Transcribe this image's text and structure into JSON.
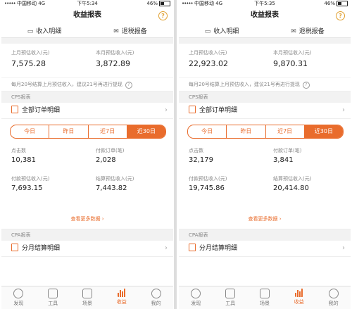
{
  "screens": [
    {
      "status": {
        "signal": "•••••",
        "carrier": "中国移动 4G",
        "time": "下午5:34",
        "battery": "46%"
      },
      "title": "收益报表",
      "tabs": [
        "收入明细",
        "退税报备"
      ],
      "last_month_label": "上月预估收入(元)",
      "last_month_value": "7,575.28",
      "this_month_label": "本月预估收入(元)",
      "this_month_value": "3,872.89",
      "hint": "每月20号结算上月预估收入，建议21号再进行提现",
      "cps_title": "CPS报表",
      "all_orders": "全部订单明细",
      "segments": [
        "今日",
        "昨日",
        "近7日",
        "近30日"
      ],
      "active_segment": 3,
      "clicks_label": "点击数",
      "clicks_value": "10,381",
      "paid_orders_label": "付款订单(笔)",
      "paid_orders_value": "2,028",
      "paid_est_label": "付款预估收入(元)",
      "paid_est_value": "7,693.15",
      "settle_est_label": "结算预估收入(元)",
      "settle_est_value": "7,443.82",
      "more": "查看更多数据",
      "cpa_title": "CPA报表",
      "monthly": "分月结算明细",
      "tabbar": [
        "发现",
        "工具",
        "场景",
        "收益",
        "我的"
      ],
      "active_tab": 3
    },
    {
      "status": {
        "signal": "•••••",
        "carrier": "中国移动 4G",
        "time": "下午5:35",
        "battery": "46%"
      },
      "title": "收益报表",
      "tabs": [
        "收入明细",
        "退税报备"
      ],
      "last_month_label": "上月预估收入(元)",
      "last_month_value": "22,923.02",
      "this_month_label": "本月预估收入(元)",
      "this_month_value": "9,870.31",
      "hint": "每月20号结算上月预估收入，建议21号再进行提现",
      "cps_title": "CPS报表",
      "all_orders": "全部订单明细",
      "segments": [
        "今日",
        "昨日",
        "近7日",
        "近30日"
      ],
      "active_segment": 3,
      "clicks_label": "点击数",
      "clicks_value": "32,179",
      "paid_orders_label": "付款订单(笔)",
      "paid_orders_value": "3,841",
      "paid_est_label": "付款预估收入(元)",
      "paid_est_value": "19,745.86",
      "settle_est_label": "结算预估收入(元)",
      "settle_est_value": "20,414.80",
      "more": "查看更多数据",
      "cpa_title": "CPA报表",
      "monthly": "分月结算明细",
      "tabbar": [
        "发现",
        "工具",
        "场景",
        "收益",
        "我的"
      ],
      "active_tab": 3
    }
  ],
  "colors": {
    "accent": "#e96c2c",
    "muted": "#888888",
    "section_bg": "#f2f2f2"
  },
  "icons": {
    "help": "help-circle-icon",
    "chevron": "chevron-right-icon"
  }
}
